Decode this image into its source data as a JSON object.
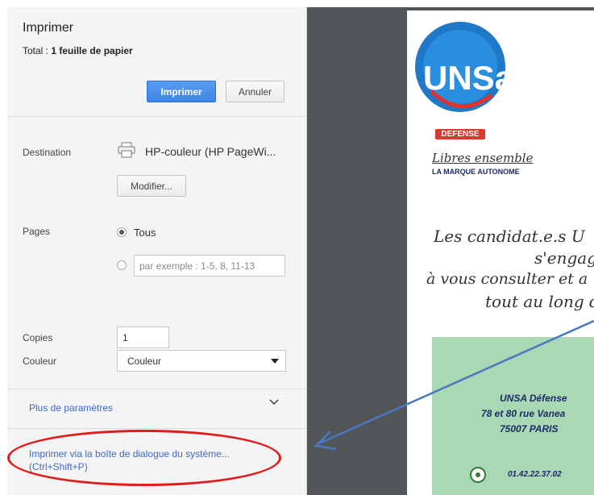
{
  "dialog": {
    "title": "Imprimer",
    "total_prefix": "Total : ",
    "total_value": "1 feuille de papier",
    "print_button": "Imprimer",
    "cancel_button": "Annuler"
  },
  "destination": {
    "label": "Destination",
    "printer": "HP-couleur (HP PageWi...",
    "change_button": "Modifier..."
  },
  "pages": {
    "label": "Pages",
    "option_all": "Tous",
    "selected": "Tous",
    "custom_placeholder": "par exemple : 1-5, 8, 11-13"
  },
  "copies": {
    "label": "Copies",
    "value": "1"
  },
  "color": {
    "label": "Couleur",
    "value": "Couleur"
  },
  "more_settings": {
    "label": "Plus de paramètres"
  },
  "system_dialog": {
    "line1": "Imprimer via la boîte de dialogue du système...",
    "line2": "(Ctrl+Shift+P)"
  },
  "preview": {
    "logo_letters": "UNSa",
    "logo_badge": "DEFENSE",
    "slogan": "Libres ensemble",
    "slogan_sub": "LA MARQUE AUTONOME",
    "line1": "Les candidat.e.s U",
    "line2": "s'engag",
    "line3": "à vous consulter et a",
    "line4": "tout au long de",
    "org": "UNSA Défense",
    "address": "78 et 80 rue Vanea",
    "city": "75007 PARIS",
    "phone": "01.42.22.37.02"
  },
  "colors": {
    "annotation_red": "#e11c1c",
    "annotation_blue": "#4a78c0",
    "print_blue": "#3d84e6"
  },
  "icons": [
    "printer-icon",
    "chevron-down-icon",
    "select-arrow-icon",
    "whatsapp-icon"
  ]
}
